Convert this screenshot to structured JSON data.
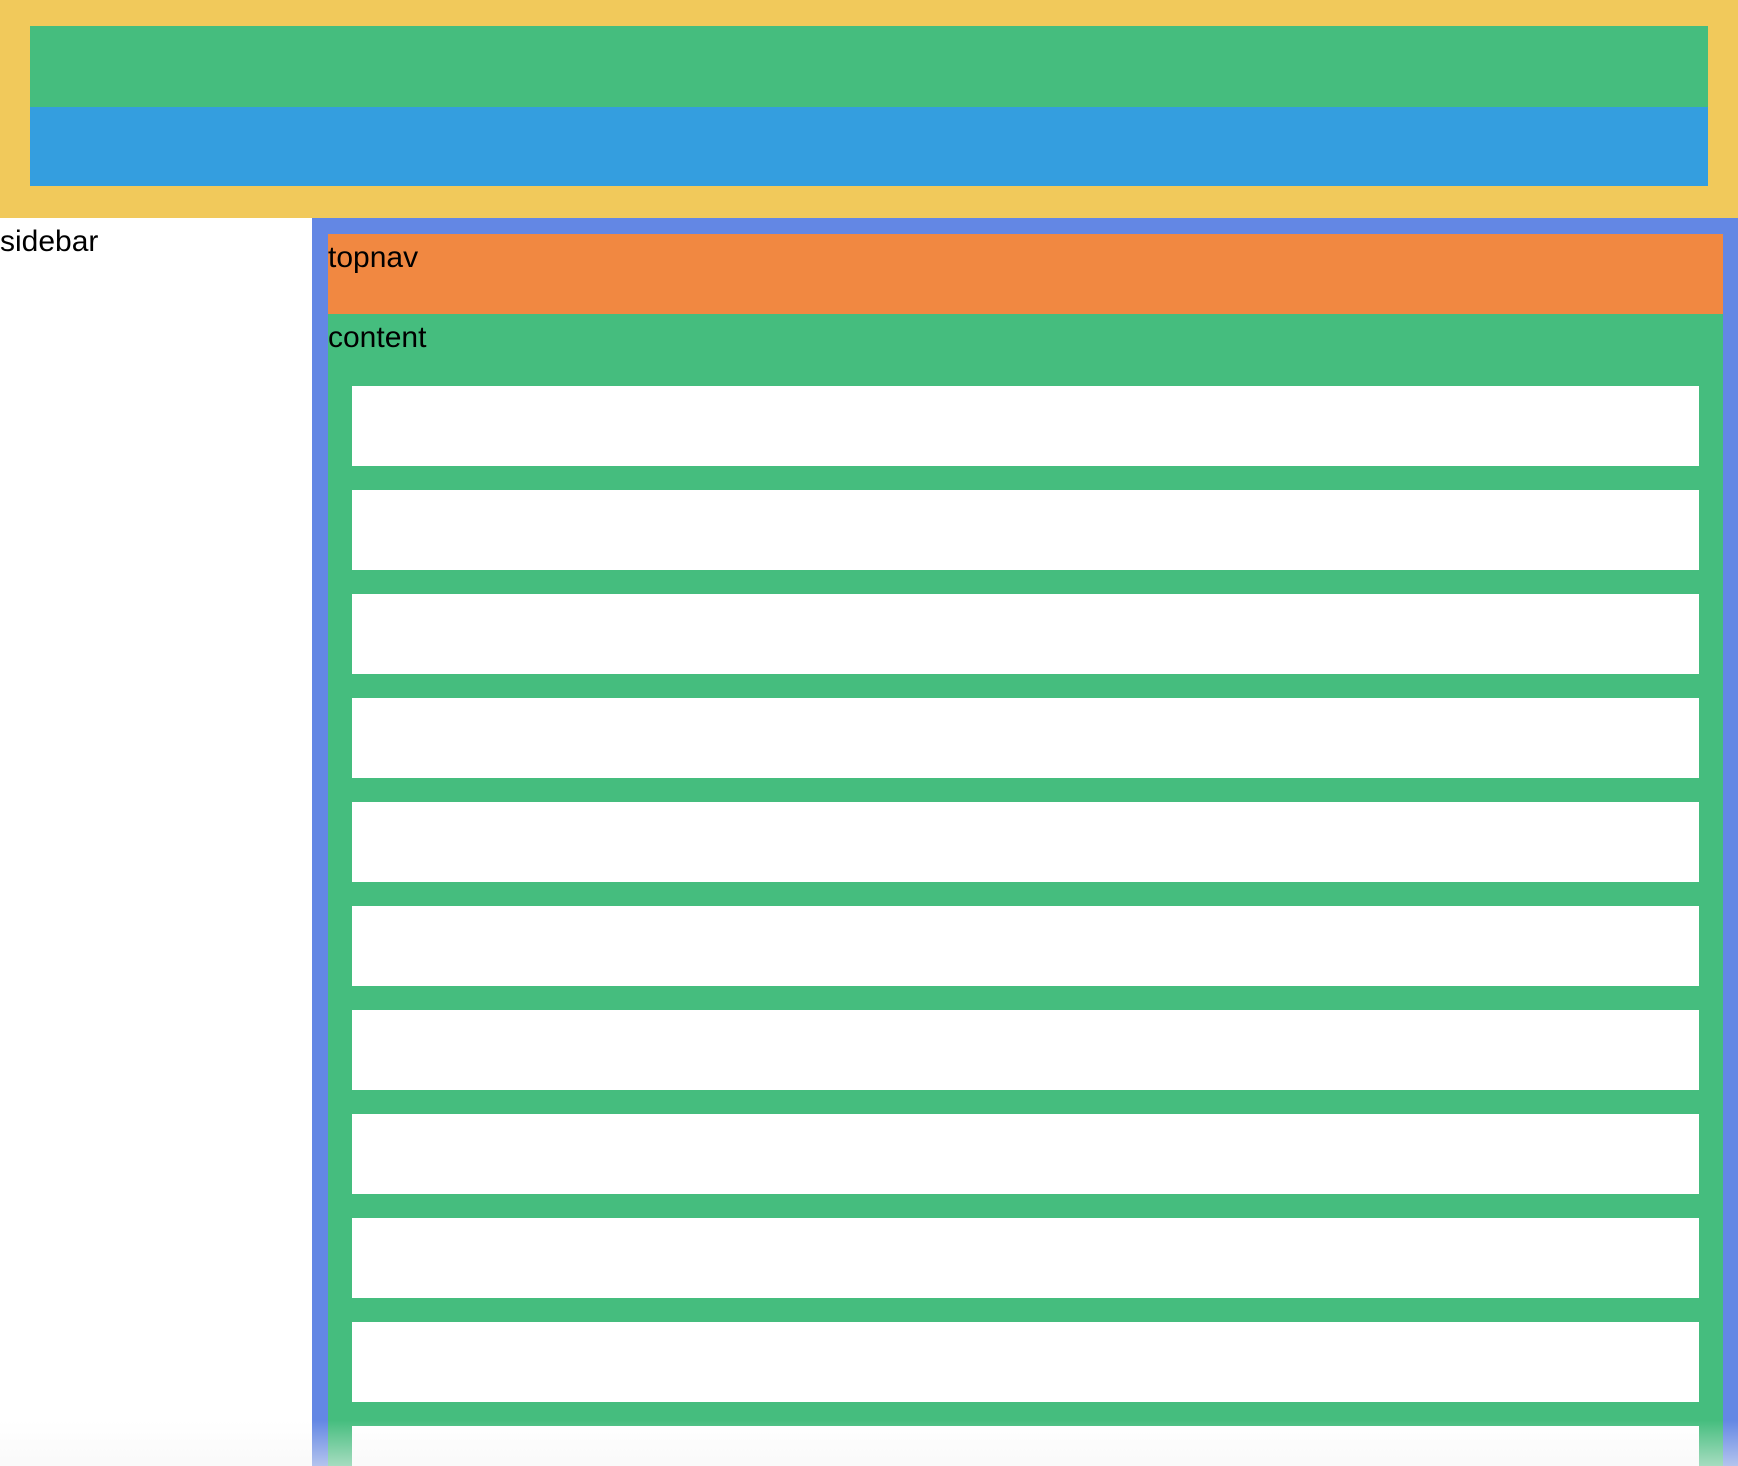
{
  "colors": {
    "header_bg": "#F1C95B",
    "header_top_band": "#45BD7E",
    "header_bottom_band": "#349EDF",
    "main_frame": "#6387E4",
    "topnav_bg": "#F18841",
    "content_bg": "#45BD7E",
    "content_row_bg": "#FFFFFF"
  },
  "sidebar": {
    "label": "sidebar"
  },
  "topnav": {
    "label": "topnav"
  },
  "content": {
    "label": "content",
    "rows": [
      {
        "id": "row-1"
      },
      {
        "id": "row-2"
      },
      {
        "id": "row-3"
      },
      {
        "id": "row-4"
      },
      {
        "id": "row-5"
      },
      {
        "id": "row-6"
      },
      {
        "id": "row-7"
      },
      {
        "id": "row-8"
      },
      {
        "id": "row-9"
      },
      {
        "id": "row-10"
      },
      {
        "id": "row-11"
      }
    ]
  }
}
